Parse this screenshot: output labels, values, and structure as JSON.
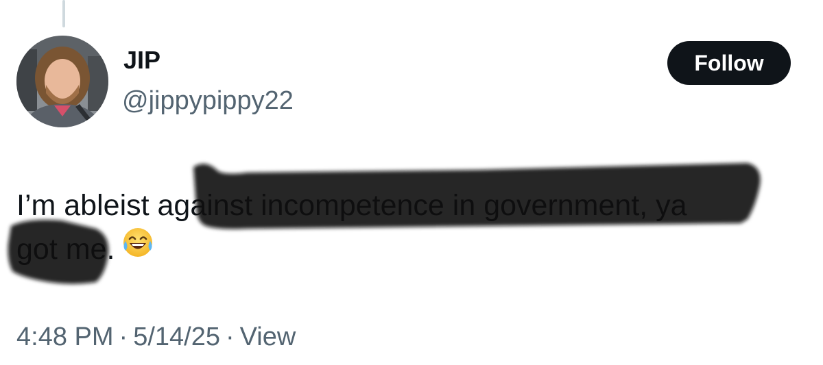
{
  "author": {
    "display_name": "JIP",
    "handle": "@jippypippy22",
    "avatar_icon": "user-photo"
  },
  "follow_button": {
    "label": "Follow"
  },
  "tweet": {
    "line1": "I’m ableist against incompetence in government, ya",
    "line2": "got me.",
    "emoji_icon": "face-with-tears-of-joy-icon"
  },
  "meta": {
    "time": "4:48 PM",
    "separator": "·",
    "date": "5/14/25",
    "view_label": "View"
  },
  "colors": {
    "text": "#0f1419",
    "secondary": "#536471",
    "button_bg": "#0f1419",
    "thread_line": "#cfd9de",
    "redaction": "#111111"
  }
}
